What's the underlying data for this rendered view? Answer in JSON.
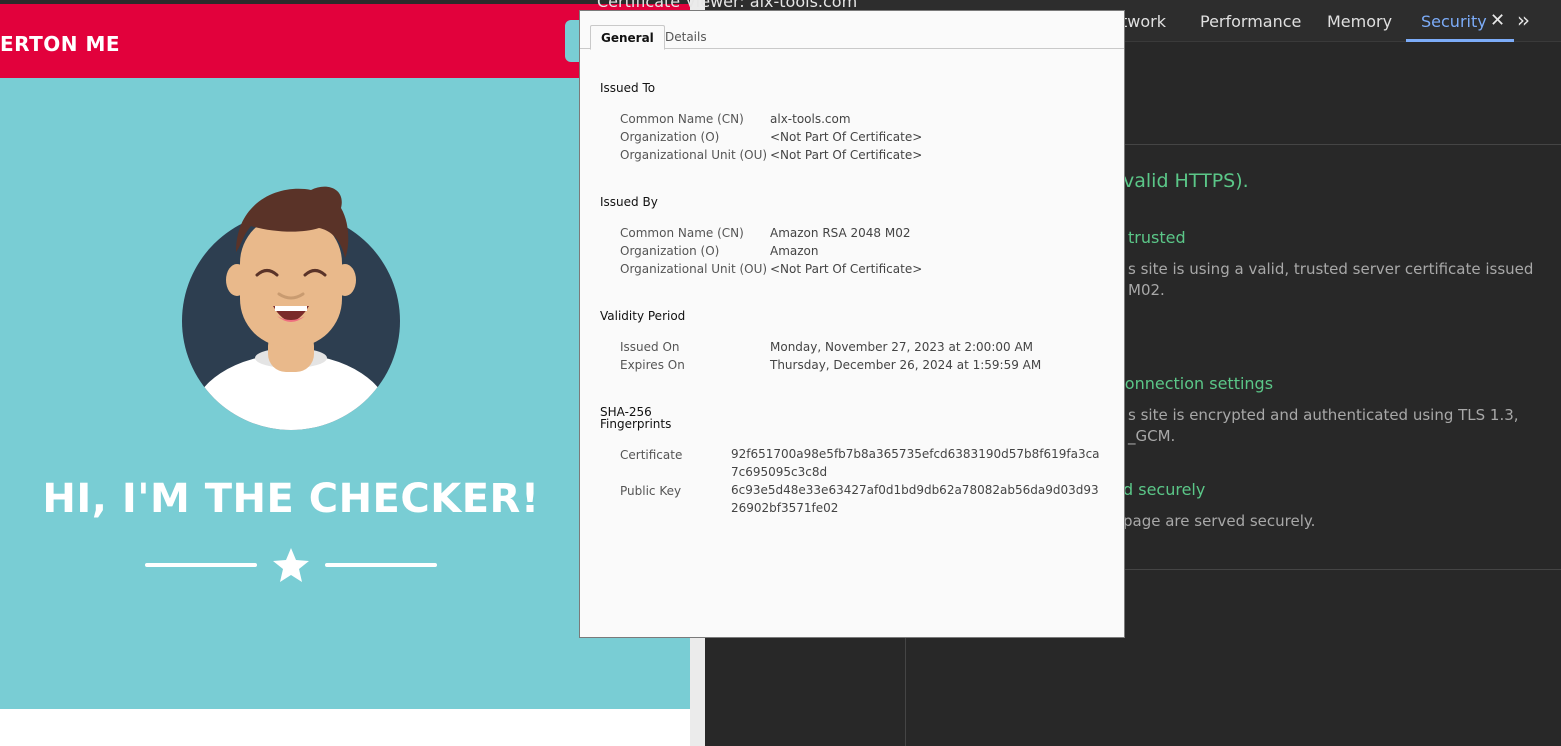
{
  "site": {
    "brand": "ERTON ME",
    "hero_title": "HI, I'M THE CHECKER!",
    "colors": {
      "header": "#e2013c",
      "hero": "#79cdd4",
      "avatar_bg": "#2d3e50"
    }
  },
  "devtools": {
    "tabs": [
      {
        "label": "twork",
        "active": false
      },
      {
        "label": "Performance",
        "active": false
      },
      {
        "label": "Memory",
        "active": false
      },
      {
        "label": "Security",
        "active": true
      }
    ],
    "close_icon": "close-icon",
    "more_icon": "chevron-double-right-icon",
    "summary": "valid HTTPS).",
    "cert_heading": "trusted",
    "cert_desc_1": "s site is using a valid, trusted server certificate issued",
    "cert_desc_2": "M02.",
    "conn_heading": "connection settings",
    "conn_desc_1": "s site is encrypted and authenticated using TLS 1.3,",
    "conn_desc_2": "_GCM.",
    "res_heading": "d securely",
    "res_desc": "page are served securely.",
    "colors": {
      "secure_green": "#5bc788",
      "active_tab": "#7cacf8"
    }
  },
  "certificate_viewer": {
    "title": "Certificate Viewer: alx-tools.com",
    "tabs": {
      "general": "General",
      "details": "Details"
    },
    "issued_to": {
      "heading": "Issued To",
      "cn_label": "Common Name (CN)",
      "cn": "alx-tools.com",
      "o_label": "Organization (O)",
      "o": "<Not Part Of Certificate>",
      "ou_label": "Organizational Unit (OU)",
      "ou": "<Not Part Of Certificate>"
    },
    "issued_by": {
      "heading": "Issued By",
      "cn_label": "Common Name (CN)",
      "cn": "Amazon RSA 2048 M02",
      "o_label": "Organization (O)",
      "o": "Amazon",
      "ou_label": "Organizational Unit (OU)",
      "ou": "<Not Part Of Certificate>"
    },
    "validity": {
      "heading": "Validity Period",
      "issued_label": "Issued On",
      "issued": "Monday, November 27, 2023 at 2:00:00 AM",
      "expires_label": "Expires On",
      "expires": "Thursday, December 26, 2024 at 1:59:59 AM"
    },
    "fingerprints": {
      "heading_1": "SHA-256",
      "heading_2": "Fingerprints",
      "cert_label": "Certificate",
      "cert": "92f651700a98e5fb7b8a365735efcd6383190d57b8f619fa3ca7c695095c3c8d",
      "key_label": "Public Key",
      "key": "6c93e5d48e33e63427af0d1bd9db62a78082ab56da9d03d9326902bf3571fe02"
    }
  }
}
